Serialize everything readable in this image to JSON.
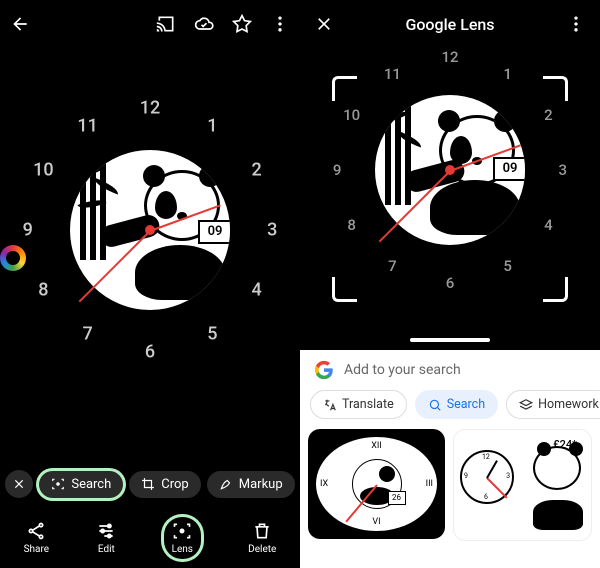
{
  "left": {
    "watch": {
      "date": "09",
      "numerals": [
        "12",
        "1",
        "2",
        "3",
        "4",
        "5",
        "6",
        "7",
        "8",
        "9",
        "10",
        "11"
      ]
    },
    "chips": {
      "search": "Search",
      "crop": "Crop",
      "markup": "Markup"
    },
    "actions": {
      "share": "Share",
      "edit": "Edit",
      "lens": "Lens",
      "delete": "Delete"
    }
  },
  "right": {
    "title": "Google Lens",
    "watch": {
      "date": "09",
      "numerals": [
        "12",
        "1",
        "2",
        "3",
        "4",
        "5",
        "6",
        "7",
        "8",
        "9",
        "10",
        "11"
      ]
    },
    "search_placeholder": "Add to your search",
    "pills": {
      "translate": "Translate",
      "search": "Search",
      "homework": "Homework"
    },
    "results": [
      {
        "date": "26",
        "price": null
      },
      {
        "date": null,
        "price": "£24*"
      }
    ]
  }
}
